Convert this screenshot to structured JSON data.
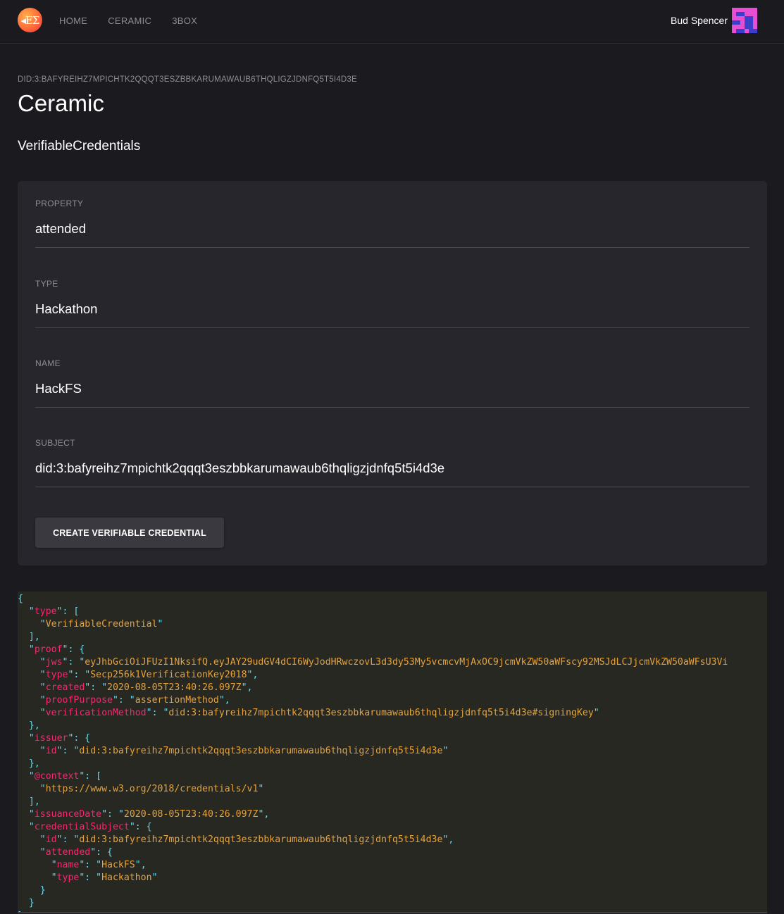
{
  "app": {
    "logo_text": "◂EΣ",
    "nav": [
      {
        "label": "HOME"
      },
      {
        "label": "CERAMIC"
      },
      {
        "label": "3BOX"
      }
    ],
    "user": {
      "name": "Bud Spencer"
    }
  },
  "page": {
    "did": "DID:3:BAFYREIHZ7MPICHTK2QQQT3ESZBBKARUMAWAUB6THQLIGZJDNFQ5T5I4D3E",
    "title": "Ceramic",
    "section_title": "VerifiableCredentials"
  },
  "form": {
    "fields": [
      {
        "label": "PROPERTY",
        "value": "attended"
      },
      {
        "label": "TYPE",
        "value": "Hackathon"
      },
      {
        "label": "NAME",
        "value": "HackFS"
      },
      {
        "label": "SUBJECT",
        "value": "did:3:bafyreihz7mpichtk2qqqt3eszbbkarumawaub6thqligzjdnfq5t5i4d3e"
      }
    ],
    "submit_label": "CREATE VERIFIABLE CREDENTIAL"
  },
  "credential_json": {
    "type_key": "type",
    "type_values": [
      "VerifiableCredential"
    ],
    "proof_key": "proof",
    "proof": {
      "jws_key": "jws",
      "jws": "eyJhbGciOiJFUzI1NksifQ.eyJAY29udGV4dCI6WyJodHRwczovL3d3dy53My5vcmcvMjAxOC9jcmVkZW50aWFscy92MSJdLCJjcmVkZW50aWFsU3Vi",
      "type_key": "type",
      "type": "Secp256k1VerificationKey2018",
      "created_key": "created",
      "created": "2020-08-05T23:40:26.097Z",
      "purpose_key": "proofPurpose",
      "purpose": "assertionMethod",
      "method_key": "verificationMethod",
      "method": "did:3:bafyreihz7mpichtk2qqqt3eszbbkarumawaub6thqligzjdnfq5t5i4d3e#signingKey"
    },
    "issuer_key": "issuer",
    "issuer": {
      "id_key": "id",
      "id": "did:3:bafyreihz7mpichtk2qqqt3eszbbkarumawaub6thqligzjdnfq5t5i4d3e"
    },
    "context_key": "@context",
    "context_values": [
      "https://www.w3.org/2018/credentials/v1"
    ],
    "issuance_key": "issuanceDate",
    "issuance_date": "2020-08-05T23:40:26.097Z",
    "subject_key": "credentialSubject",
    "subject": {
      "id_key": "id",
      "id": "did:3:bafyreihz7mpichtk2qqqt3eszbbkarumawaub6thqligzjdnfq5t5i4d3e",
      "attended_key": "attended",
      "name_key": "name",
      "name": "HackFS",
      "type_key": "type",
      "type": "Hackathon"
    }
  },
  "colors": {
    "background": "#1b1a1f",
    "card": "#27262c",
    "json_background": "#272822",
    "json_key": "#f92672",
    "json_string": "#e6a23c",
    "json_punct": "#66d9ef",
    "avatar_pink": "#e64fd1",
    "avatar_blue": "#3b3fc9"
  }
}
